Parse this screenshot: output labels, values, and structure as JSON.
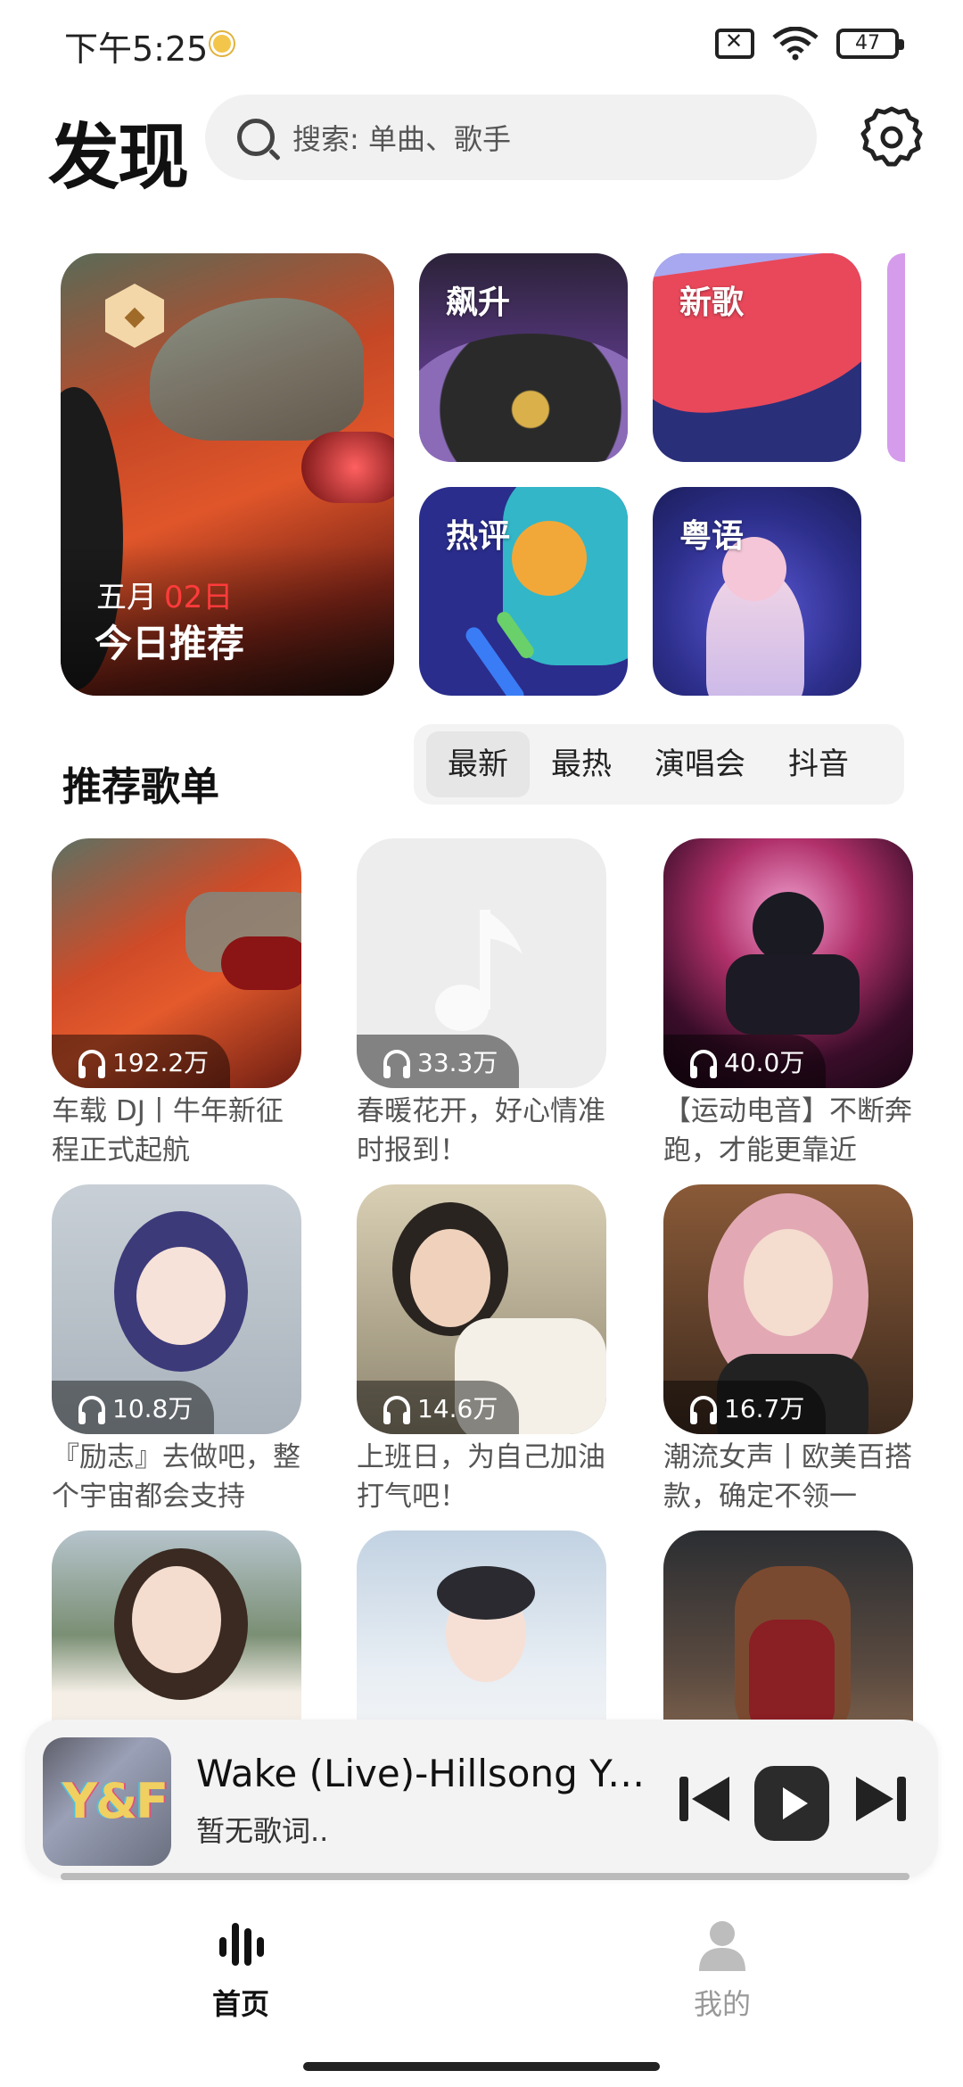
{
  "status_bar": {
    "time": "下午5:25",
    "battery": "47"
  },
  "header": {
    "title": "发现",
    "search_placeholder": "搜索: 单曲、歌手"
  },
  "featured": {
    "main": {
      "month": "五月",
      "day": "02日",
      "title": "今日推荐"
    },
    "tiles": [
      "飙升",
      "新歌",
      "热评",
      "粤语"
    ]
  },
  "playlists": {
    "section_title": "推荐歌单",
    "tabs": [
      "最新",
      "最热",
      "演唱会",
      "抖音"
    ],
    "active_tab": "最新",
    "items": [
      {
        "plays": "192.2万",
        "title": "车载 DJ丨牛年新征程正式起航"
      },
      {
        "plays": "33.3万",
        "title": "春暖花开，好心情准时报到！"
      },
      {
        "plays": "40.0万",
        "title": "【运动电音】不断奔跑，才能更靠近"
      },
      {
        "plays": "10.8万",
        "title": "『励志』去做吧，整个宇宙都会支持"
      },
      {
        "plays": "14.6万",
        "title": "上班日，为自己加油打气吧！"
      },
      {
        "plays": "16.7万",
        "title": "潮流女声丨欧美百搭款，确定不领一"
      }
    ]
  },
  "mini_player": {
    "cover_text": "Y&F",
    "title": "Wake (Live)-Hillsong Yo...",
    "lyric": "暂无歌词.."
  },
  "bottom_nav": {
    "home": "首页",
    "me": "我的"
  }
}
